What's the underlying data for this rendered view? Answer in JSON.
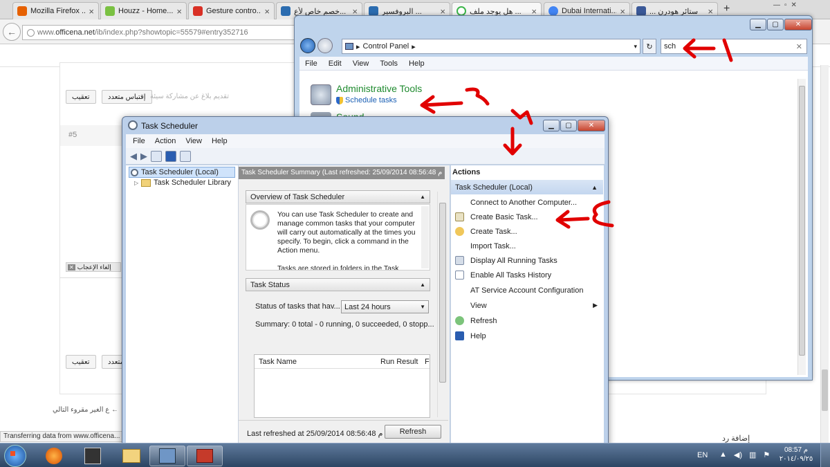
{
  "browser": {
    "tabs": [
      {
        "title": "Mozilla Firefox ...",
        "color": "#e66000"
      },
      {
        "title": "Houzz - Home...",
        "color": "#7ac142"
      },
      {
        "title": "Gesture contro...",
        "color": "#d93025"
      },
      {
        "title": "خصم خاص لأع...",
        "color": "#2b6cb0"
      },
      {
        "title": "البروفسير ...",
        "color": "#2b6cb0"
      },
      {
        "title": "هل يوجد ملف ...",
        "color": "#3bb54a"
      },
      {
        "title": "Dubai Internati...",
        "color": "#4285f4"
      },
      {
        "title": "... ستائر هودرن",
        "color": "#3b5998"
      }
    ],
    "url_prefix": "www.",
    "url_domain": "officena.net",
    "url_path": "/ib/index.php?showtopic=55579#entry352716",
    "status": "Transferring data from www.officena..."
  },
  "forum": {
    "reply_button": "تعقيب",
    "multiquote_button": "إقتباس متعدد",
    "report_text": "تقديم بلاغ عن مشاركة سيئة",
    "post_number": "#5",
    "unlike_text": "إلغاء الإعجاب",
    "multiquote_partial": "متعدد",
    "next_link": "ع الغير مقروء التالي ←",
    "add_reply": "إضافة رد"
  },
  "control_panel": {
    "breadcrumb": "Control Panel",
    "search_value": "sch",
    "menu": [
      "File",
      "Edit",
      "View",
      "Tools",
      "Help"
    ],
    "heading": "Administrative Tools",
    "link": "Schedule tasks",
    "next_heading": "Sound"
  },
  "task_scheduler": {
    "title": "Task Scheduler",
    "menu": [
      "File",
      "Action",
      "View",
      "Help"
    ],
    "tree_root": "Task Scheduler (Local)",
    "tree_child": "Task Scheduler Library",
    "summary_header": "Task Scheduler Summary (Last refreshed: 25/09/2014 08:56:48 م",
    "overview_title": "Overview of Task Scheduler",
    "overview_text": "You can use Task Scheduler to create and manage common tasks that your computer will carry out automatically at the times you specify. To begin, click a command in the Action menu.",
    "overview_text2": "Tasks are stored in folders in the Task",
    "status_title": "Task Status",
    "status_label": "Status of tasks that hav...",
    "status_select": "Last 24 hours",
    "summary": "Summary: 0 total - 0 running, 0 succeeded, 0 stopp...",
    "col_name": "Task Name",
    "col_result": "Run Result",
    "col_extra": "F",
    "last_refreshed": "Last refreshed at 25/09/2014 08:56:48 م",
    "refresh_button": "Refresh",
    "actions_header": "Actions",
    "actions_group": "Task Scheduler (Local)",
    "actions": [
      {
        "label": "Connect to Another Computer...",
        "icon": "none"
      },
      {
        "label": "Create Basic Task...",
        "icon": "create-basic-task-icon"
      },
      {
        "label": "Create Task...",
        "icon": "create-task-icon"
      },
      {
        "label": "Import Task...",
        "icon": "none"
      },
      {
        "label": "Display All Running Tasks",
        "icon": "running-tasks-icon"
      },
      {
        "label": "Enable All Tasks History",
        "icon": "history-icon"
      },
      {
        "label": "AT Service Account Configuration",
        "icon": "none"
      },
      {
        "label": "View",
        "icon": "none"
      },
      {
        "label": "Refresh",
        "icon": "refresh-icon"
      },
      {
        "label": "Help",
        "icon": "help-icon"
      }
    ]
  },
  "annotations": {
    "step1": "١",
    "step2": "٢",
    "step3": "٣",
    "step4": "٤",
    "color": "#e10000"
  },
  "taskbar": {
    "lang": "EN",
    "time": "08:57 م",
    "date": "٢٠١٤/٠٩/٢٥"
  }
}
